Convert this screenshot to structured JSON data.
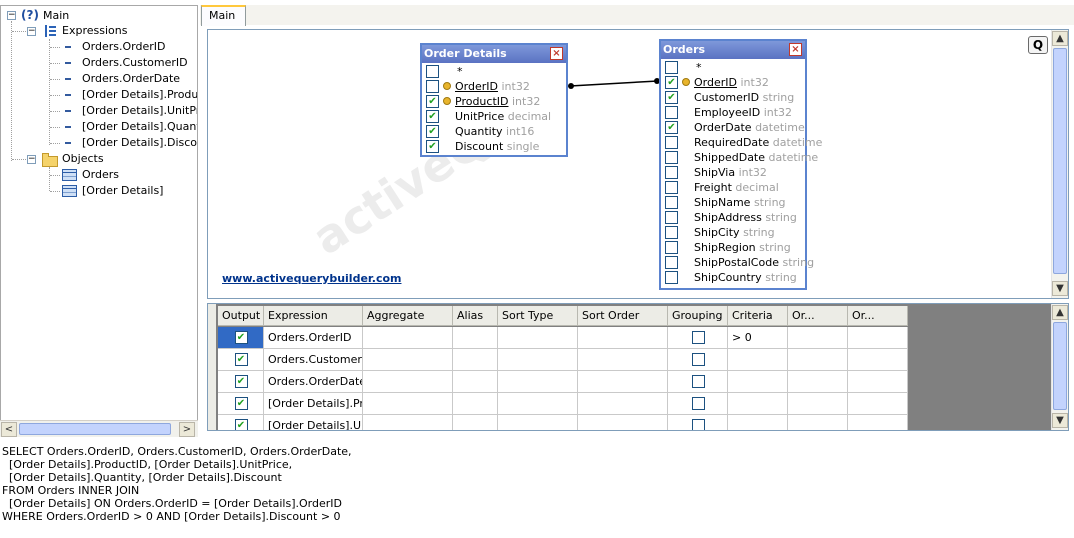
{
  "tree": {
    "root_label": "Main",
    "expressions_label": "Expressions",
    "expressions": [
      "Orders.OrderID",
      "Orders.CustomerID",
      "Orders.OrderDate",
      "[Order Details].ProductID",
      "[Order Details].UnitPrice",
      "[Order Details].Quantity",
      "[Order Details].Discount"
    ],
    "objects_label": "Objects",
    "objects": [
      "Orders",
      "[Order Details]"
    ],
    "scroll_left": "<",
    "scroll_right": ">"
  },
  "tabs": [
    {
      "label": "Main"
    }
  ],
  "diagram": {
    "q_button": "Q",
    "web_link": "www.activequerybuilder.com",
    "watermark": "activeQ",
    "order_details": {
      "title": "Order Details",
      "close": "×",
      "fields": [
        {
          "name": "*",
          "type": "",
          "checked": false,
          "key": false
        },
        {
          "name": "OrderID",
          "type": "int32",
          "checked": false,
          "key": true
        },
        {
          "name": "ProductID",
          "type": "int32",
          "checked": true,
          "key": true
        },
        {
          "name": "UnitPrice",
          "type": "decimal",
          "checked": true,
          "key": false
        },
        {
          "name": "Quantity",
          "type": "int16",
          "checked": true,
          "key": false
        },
        {
          "name": "Discount",
          "type": "single",
          "checked": true,
          "key": false
        }
      ]
    },
    "orders": {
      "title": "Orders",
      "close": "×",
      "fields": [
        {
          "name": "*",
          "type": "",
          "checked": false,
          "key": false
        },
        {
          "name": "OrderID",
          "type": "int32",
          "checked": true,
          "key": true
        },
        {
          "name": "CustomerID",
          "type": "string",
          "checked": true,
          "key": false
        },
        {
          "name": "EmployeeID",
          "type": "int32",
          "checked": false,
          "key": false
        },
        {
          "name": "OrderDate",
          "type": "datetime",
          "checked": true,
          "key": false
        },
        {
          "name": "RequiredDate",
          "type": "datetime",
          "checked": false,
          "key": false
        },
        {
          "name": "ShippedDate",
          "type": "datetime",
          "checked": false,
          "key": false
        },
        {
          "name": "ShipVia",
          "type": "int32",
          "checked": false,
          "key": false
        },
        {
          "name": "Freight",
          "type": "decimal",
          "checked": false,
          "key": false
        },
        {
          "name": "ShipName",
          "type": "string",
          "checked": false,
          "key": false
        },
        {
          "name": "ShipAddress",
          "type": "string",
          "checked": false,
          "key": false
        },
        {
          "name": "ShipCity",
          "type": "string",
          "checked": false,
          "key": false
        },
        {
          "name": "ShipRegion",
          "type": "string",
          "checked": false,
          "key": false
        },
        {
          "name": "ShipPostalCode",
          "type": "string",
          "checked": false,
          "key": false
        },
        {
          "name": "ShipCountry",
          "type": "string",
          "checked": false,
          "key": false
        }
      ]
    }
  },
  "grid": {
    "columns": [
      "Output",
      "Expression",
      "Aggregate",
      "Alias",
      "Sort Type",
      "Sort Order",
      "Grouping",
      "Criteria",
      "Or...",
      "Or..."
    ],
    "rows": [
      {
        "output": true,
        "expression": "Orders.OrderID",
        "grouping": false,
        "criteria": "> 0"
      },
      {
        "output": true,
        "expression": "Orders.CustomerID",
        "grouping": false,
        "criteria": ""
      },
      {
        "output": true,
        "expression": "Orders.OrderDate",
        "grouping": false,
        "criteria": ""
      },
      {
        "output": true,
        "expression": "[Order Details].Pr...",
        "grouping": false,
        "criteria": ""
      },
      {
        "output": true,
        "expression": "[Order Details].U...",
        "grouping": false,
        "criteria": ""
      }
    ]
  },
  "sql": [
    "SELECT Orders.OrderID, Orders.CustomerID, Orders.OrderDate,",
    "  [Order Details].ProductID, [Order Details].UnitPrice,",
    "  [Order Details].Quantity, [Order Details].Discount",
    "FROM Orders INNER JOIN",
    "  [Order Details] ON Orders.OrderID = [Order Details].OrderID",
    "WHERE Orders.OrderID > 0 AND [Order Details].Discount > 0"
  ],
  "colors": {
    "table_border": "#5b83cf",
    "title_bar": "#6a84cc",
    "link": "#00338c",
    "tab_highlight": "#ffc83c",
    "check": "#21a121"
  }
}
